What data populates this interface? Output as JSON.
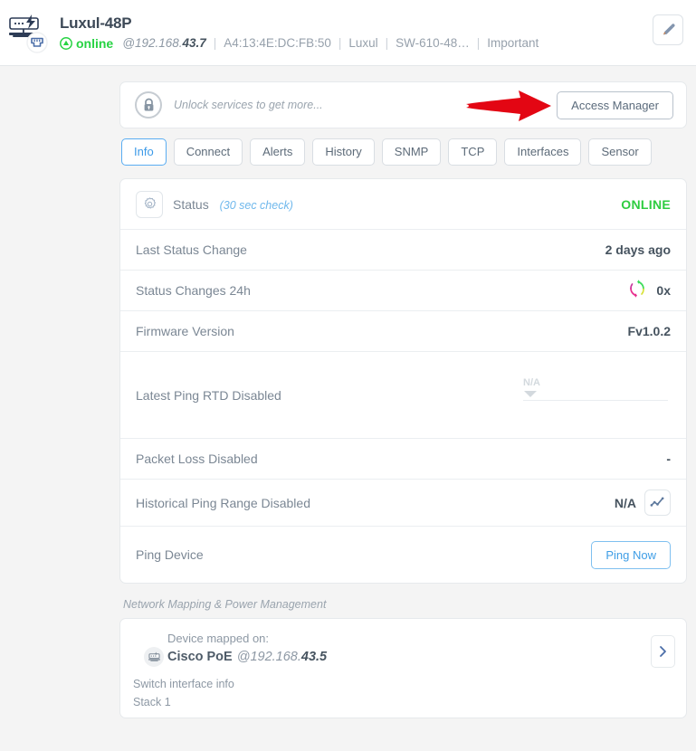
{
  "header": {
    "device_icon": "network-switch-icon",
    "title": "Luxul-48P",
    "status": "online",
    "status_color": "#27d343",
    "ip_prefix": "@192.168.",
    "ip_suffix": "43.7",
    "mac": "A4:13:4E:DC:FB:50",
    "vendor": "Luxul",
    "model": "SW-610-48…",
    "tag": "Important",
    "edit_icon": "pencil-icon"
  },
  "unlock": {
    "lock_icon": "lock-icon",
    "message": "Unlock services to get more...",
    "access_button": "Access Manager",
    "arrow_annotation_color": "#e30613"
  },
  "tabs": [
    {
      "label": "Info",
      "active": true
    },
    {
      "label": "Connect",
      "active": false
    },
    {
      "label": "Alerts",
      "active": false
    },
    {
      "label": "History",
      "active": false
    },
    {
      "label": "SNMP",
      "active": false
    },
    {
      "label": "TCP",
      "active": false
    },
    {
      "label": "Interfaces",
      "active": false
    },
    {
      "label": "Sensor",
      "active": false
    }
  ],
  "info": {
    "status_row": {
      "gear_icon": "gear-icon",
      "label": "Status",
      "check_interval": "(30 sec check)",
      "value": "ONLINE",
      "value_color": "#2ecc40"
    },
    "last_status_change": {
      "label": "Last Status Change",
      "value": "2 days ago"
    },
    "status_changes_24h": {
      "label": "Status Changes 24h",
      "value": "0x",
      "icon": "cycle-arrows-icon"
    },
    "firmware_version": {
      "label": "Firmware Version",
      "value": "Fv1.0.2"
    },
    "latest_ping_rtd": {
      "label": "Latest Ping RTD Disabled",
      "gauge_value": "N/A"
    },
    "packet_loss": {
      "label": "Packet Loss Disabled",
      "value": "-"
    },
    "historical_ping_range": {
      "label": "Historical Ping Range Disabled",
      "value": "N/A",
      "icon": "line-chart-icon"
    },
    "ping_device": {
      "label": "Ping Device",
      "button": "Ping Now"
    }
  },
  "mapping": {
    "section_title": "Network Mapping & Power Management",
    "mapped_label": "Device mapped on:",
    "device_icon": "switch-small-icon",
    "device_name": "Cisco PoE",
    "device_ip_prefix": "@192.168.",
    "device_ip_suffix": "43.5",
    "interface_info_label": "Switch interface info",
    "stack": "Stack 1",
    "next_icon": "chevron-right-icon"
  }
}
